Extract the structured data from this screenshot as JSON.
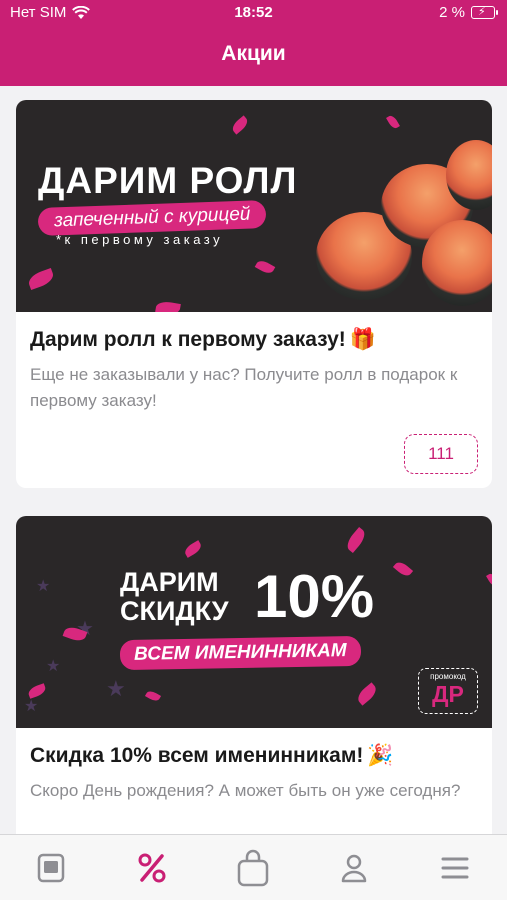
{
  "status_bar": {
    "carrier": "Нет SIM",
    "time": "18:52",
    "battery": "2 %"
  },
  "nav": {
    "title": "Акции"
  },
  "promotions": [
    {
      "banner": {
        "headline": "ДАРИМ РОЛЛ",
        "tagline": "запеченный с курицей",
        "note": "*к первому заказу"
      },
      "title": "Дарим ролл к первому заказу!",
      "title_emoji": "🎁",
      "description": "Еще не заказывали у нас? Получите ролл в подарок к первому заказу!",
      "promo_code": "111"
    },
    {
      "banner": {
        "headline_line1": "ДАРИМ",
        "headline_line2": "СКИДКУ",
        "percent": "10%",
        "tagline": "ВСЕМ ИМЕНИННИКАМ",
        "stamp_label": "промокод",
        "stamp_code": "ДР"
      },
      "title": "Скидка 10% всем именинникам!",
      "title_emoji": "🎉",
      "description": "Скоро День рождения? А может быть он уже сегодня?"
    }
  ],
  "tabbar": {
    "items": [
      "menu-icon",
      "promotions-icon",
      "cart-icon",
      "profile-icon",
      "more-icon"
    ],
    "active": "promotions-icon",
    "active_color": "#c91f74",
    "inactive_color": "#8e8e93"
  },
  "colors": {
    "accent": "#c91f74"
  }
}
